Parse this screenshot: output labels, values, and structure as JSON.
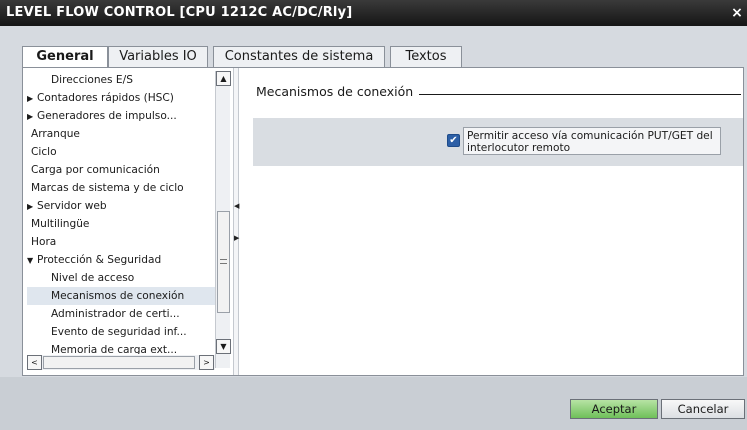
{
  "window": {
    "title": "LEVEL FLOW  CONTROL [CPU 1212C AC/DC/Rly]",
    "close_glyph": "×"
  },
  "tabs": [
    {
      "label": "General"
    },
    {
      "label": "Variables IO"
    },
    {
      "label": "Constantes de sistema"
    },
    {
      "label": "Textos"
    }
  ],
  "tree": {
    "items": [
      {
        "label": "Direcciones E/S",
        "expandable": false
      },
      {
        "label": "Contadores rápidos (HSC)",
        "expandable": true
      },
      {
        "label": "Generadores de impulso...",
        "expandable": true
      },
      {
        "label": "Arranque",
        "expandable": false
      },
      {
        "label": "Ciclo",
        "expandable": false
      },
      {
        "label": "Carga por comunicación",
        "expandable": false
      },
      {
        "label": "Marcas de sistema y de ciclo",
        "expandable": false
      },
      {
        "label": "Servidor web",
        "expandable": true
      },
      {
        "label": "Multilingüe",
        "expandable": false
      },
      {
        "label": "Hora",
        "expandable": false
      },
      {
        "label": "Protección & Seguridad",
        "expandable": true,
        "expanded": true
      },
      {
        "label": "Nivel de acceso",
        "expandable": false
      },
      {
        "label": "Mecanismos de conexión",
        "expandable": false,
        "selected": true
      },
      {
        "label": "Administrador de certi...",
        "expandable": false
      },
      {
        "label": "Evento de seguridad inf...",
        "expandable": false
      },
      {
        "label": "Memoria de carga ext...",
        "expandable": false
      }
    ]
  },
  "section": {
    "title": "Mecanismos de conexión",
    "checkbox_label": "Permitir acceso vía comunicación PUT/GET del interlocutor remoto",
    "checkbox_checked": true
  },
  "buttons": {
    "ok": "Aceptar",
    "cancel": "Cancelar"
  },
  "colors": {
    "title_bar": "#1a1a1a",
    "ok_button": "#6fc05a",
    "checkbox": "#2d5fa6"
  },
  "icons": {
    "tree_expand": "▶",
    "tree_expanded": "▼",
    "scroll_up": "▲",
    "scroll_down": "▼",
    "scroll_left": "<",
    "scroll_right": ">",
    "checkmark": "✔"
  }
}
